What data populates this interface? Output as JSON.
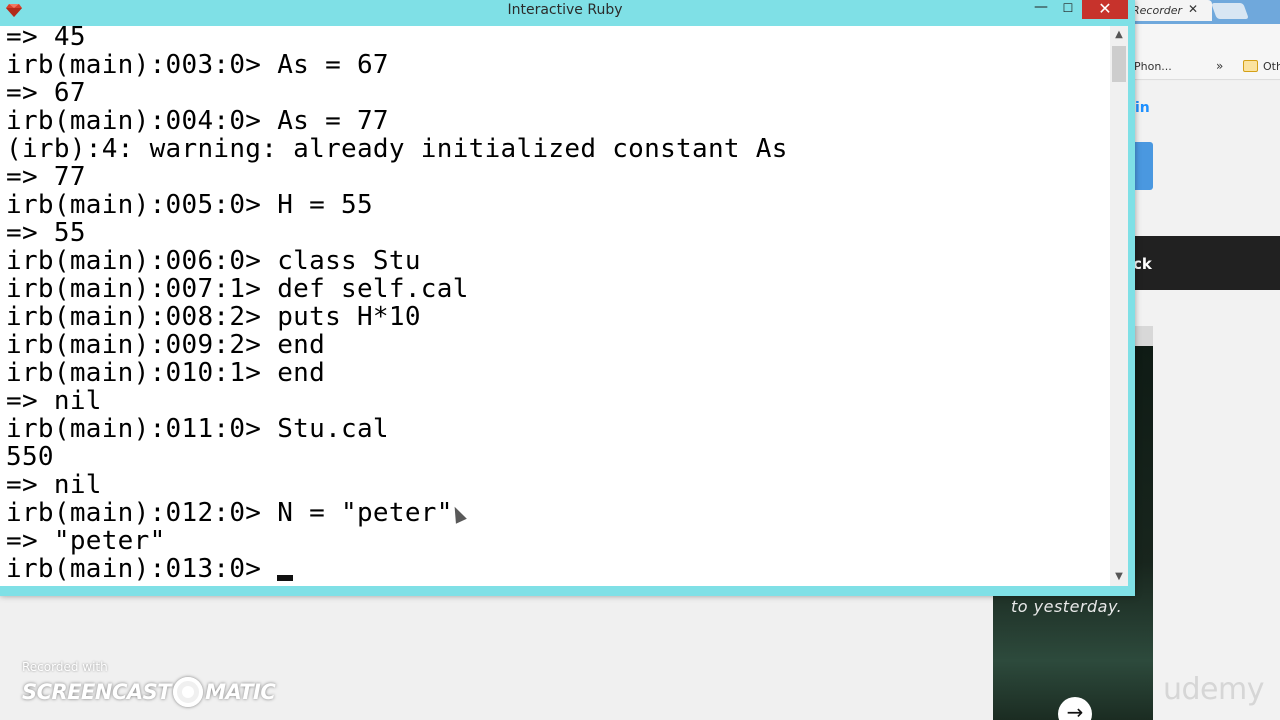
{
  "window": {
    "title": "Interactive Ruby",
    "minimize_glyph": "—",
    "maximize_glyph": "☐",
    "close_glyph": "✕"
  },
  "console": {
    "lines": [
      "=> 45",
      "irb(main):003:0> As = 67",
      "=> 67",
      "irb(main):004:0> As = 77",
      "(irb):4: warning: already initialized constant As",
      "=> 77",
      "irb(main):005:0> H = 55",
      "=> 55",
      "irb(main):006:0> class Stu",
      "irb(main):007:1> def self.cal",
      "irb(main):008:2> puts H*10",
      "irb(main):009:2> end",
      "irb(main):010:1> end",
      "=> nil",
      "irb(main):011:0> Stu.cal",
      "550",
      "=> nil",
      "irb(main):012:0> N = \"peter\"",
      "=> \"peter\""
    ],
    "prompt": "irb(main):013:0> "
  },
  "scrollbar": {
    "up_glyph": "▲",
    "down_glyph": "▼"
  },
  "browser": {
    "tab_label": "Recorder",
    "tab_close_glyph": "✕",
    "bookmark_1": "Phon...",
    "bookmark_more": "»",
    "bookmark_2": "Oth",
    "link_text": "in",
    "dark_band_text": "ck",
    "video_caption": "to yesterday.",
    "play_glyph": "→",
    "brand": "udemy"
  },
  "watermark": {
    "recorded_with": "Recorded with",
    "logo_left": "SCREENCAST",
    "logo_right": "MATIC"
  },
  "colors": {
    "title_bar": "#7fe0e6",
    "close_button": "#c7332c",
    "console_bg": "#ffffff",
    "console_text": "#000000"
  }
}
